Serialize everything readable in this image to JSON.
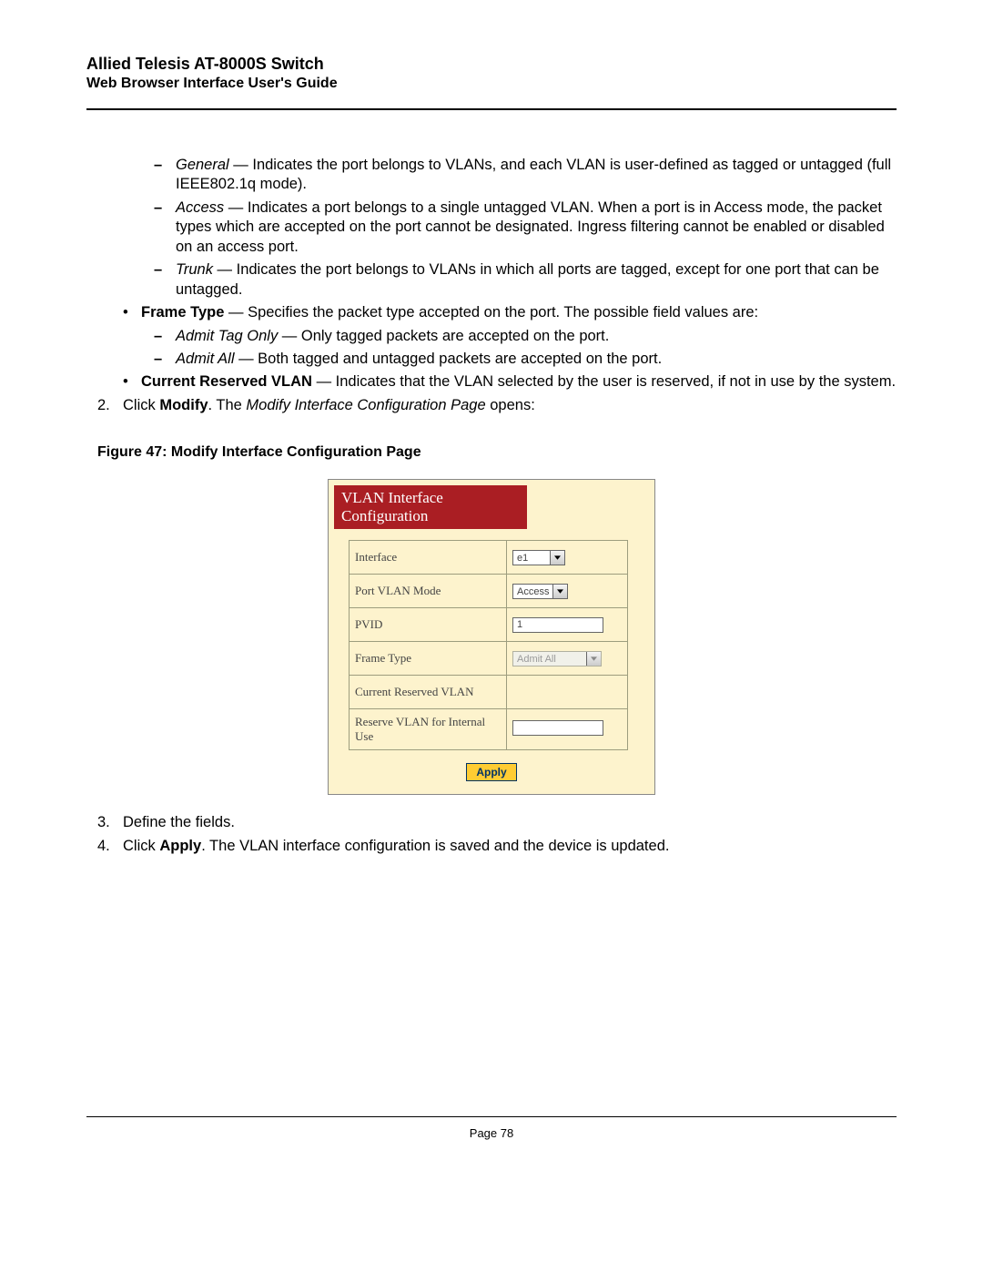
{
  "header": {
    "title": "Allied Telesis AT-8000S Switch",
    "subtitle": "Web Browser Interface User's Guide"
  },
  "body": {
    "modes": {
      "general_term": "General",
      "general_text": " — Indicates the port belongs to VLANs, and each VLAN is user-defined as tagged or untagged (full IEEE802.1q mode).",
      "access_term": "Access",
      "access_text": " — Indicates a port belongs to a single untagged VLAN. When a port is in Access mode, the packet types which are accepted on the port cannot be designated. Ingress filtering cannot be enabled or disabled on an access port.",
      "trunk_term": "Trunk",
      "trunk_text": " — Indicates the port belongs to VLANs in which all ports are tagged, except for one port that can be untagged."
    },
    "frame_type_label": "Frame Type",
    "frame_type_text": " — Specifies the packet type accepted on the port. The possible field values are:",
    "frame_vals": {
      "tag_term": "Admit Tag Only",
      "tag_text": " — Only tagged packets are accepted on the port.",
      "all_term": "Admit All",
      "all_text": " — Both tagged and untagged packets are accepted on the port."
    },
    "crv_label": "Current Reserved VLAN",
    "crv_text": " — Indicates that the VLAN selected by the user is reserved, if not in use by the system."
  },
  "steps": {
    "s2_pre": "Click ",
    "s2_bold": "Modify",
    "s2_mid": ". The ",
    "s2_ital": "Modify Interface Configuration Page",
    "s2_post": " opens:",
    "s3": "Define the fields.",
    "s4_pre": "Click ",
    "s4_bold": "Apply",
    "s4_post": ". The VLAN interface configuration is saved and the device is updated."
  },
  "figure": {
    "caption": "Figure 47:  Modify Interface Configuration Page",
    "panel_title": "VLAN Interface Configuration",
    "rows": {
      "interface": "Interface",
      "interface_val": "e1",
      "pvm": "Port VLAN Mode",
      "pvm_val": "Access",
      "pvid": "PVID",
      "pvid_val": "1",
      "ftype": "Frame Type",
      "ftype_val": "Admit All",
      "crv": "Current Reserved VLAN",
      "riu": "Reserve VLAN for Internal Use"
    },
    "apply": "Apply"
  },
  "footer": {
    "page": "Page 78"
  }
}
